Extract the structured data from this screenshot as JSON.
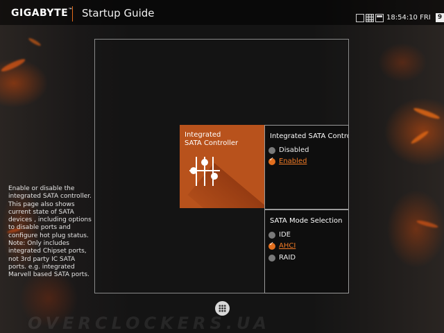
{
  "header": {
    "brand": "GIGABYTE",
    "brand_mark": "™",
    "title": "Startup Guide",
    "time": "18:54:10 FRI",
    "day": "9",
    "icons": [
      "monitor-icon",
      "grid-view-icon",
      "window-icon"
    ]
  },
  "tile": {
    "label": "Integrated\nSATA Controller",
    "icon": "sliders-icon",
    "color": "#b8521c"
  },
  "sata_controller_panel": {
    "title": "Integrated SATA Controller",
    "options": [
      {
        "label": "Disabled",
        "selected": false
      },
      {
        "label": "Enabled",
        "selected": true
      }
    ]
  },
  "sata_mode_panel": {
    "title": "SATA Mode Selection",
    "options": [
      {
        "label": "IDE",
        "selected": false
      },
      {
        "label": "AHCI",
        "selected": true
      },
      {
        "label": "RAID",
        "selected": false
      }
    ]
  },
  "help_text": "Enable or disable the integrated SATA controller.\nThis page also shows current state of SATA devices , including options to disable ports and configure hot plug status.\nNote: Only includes integrated Chipset ports, not 3rd party IC SATA ports. e.g. integrated Marvell based SATA ports.",
  "bottom": {
    "apps_icon": "apps-grid-icon",
    "watermark": "OVERCLOCKERS.UA"
  },
  "colors": {
    "accent": "#e36f1e",
    "tile": "#b8521c"
  }
}
